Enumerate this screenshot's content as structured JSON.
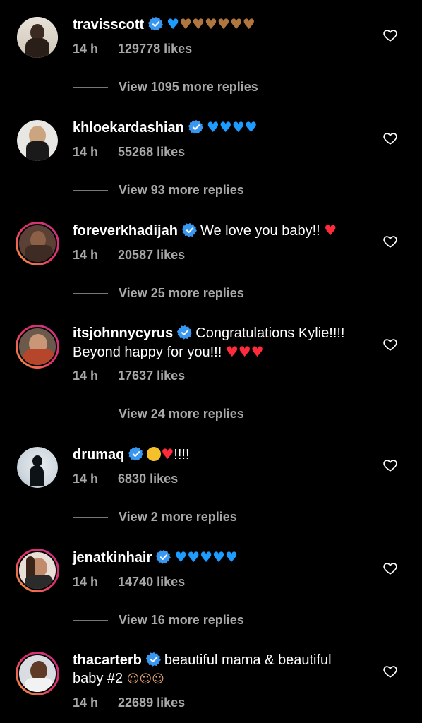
{
  "comments": [
    {
      "username": "travisscott",
      "text": "",
      "time": "14 h",
      "likes": "129778 likes",
      "replies": "View 1095 more replies"
    },
    {
      "username": "khloekardashian",
      "text": "",
      "time": "14 h",
      "likes": "55268 likes",
      "replies": "View 93 more replies"
    },
    {
      "username": "foreverkhadijah",
      "text": "We love you baby!!",
      "time": "14 h",
      "likes": "20587 likes",
      "replies": "View 25 more replies"
    },
    {
      "username": "itsjohnnycyrus",
      "text": "Congratulations Kylie!!!!",
      "text2": "Beyond happy for you!!!",
      "time": "14 h",
      "likes": "17637 likes",
      "replies": "View 24 more replies"
    },
    {
      "username": "drumaq",
      "text": "!!!!",
      "time": "14 h",
      "likes": "6830 likes",
      "replies": "View 2 more replies"
    },
    {
      "username": "jenatkinhair",
      "text": "",
      "time": "14 h",
      "likes": "14740 likes",
      "replies": "View 16 more replies"
    },
    {
      "username": "thacarterb",
      "text": "beautiful mama & beautiful",
      "text2": "baby #2",
      "time": "14 h",
      "likes": "22689 likes"
    }
  ],
  "icons": {
    "verified": "verified-badge-icon",
    "like": "heart-outline-icon",
    "blue_heart": "blue-heart-emoji",
    "brown_heart": "brown-heart-emoji",
    "red_heart": "red-heart-emoji",
    "pleading": "pleading-face-emoji",
    "angel": "baby-angel-emoji"
  },
  "colors": {
    "background": "#000000",
    "text": "#ffffff",
    "meta": "#a8a8a8",
    "verified": "#3897f0",
    "story_ring": "#e1306c"
  }
}
